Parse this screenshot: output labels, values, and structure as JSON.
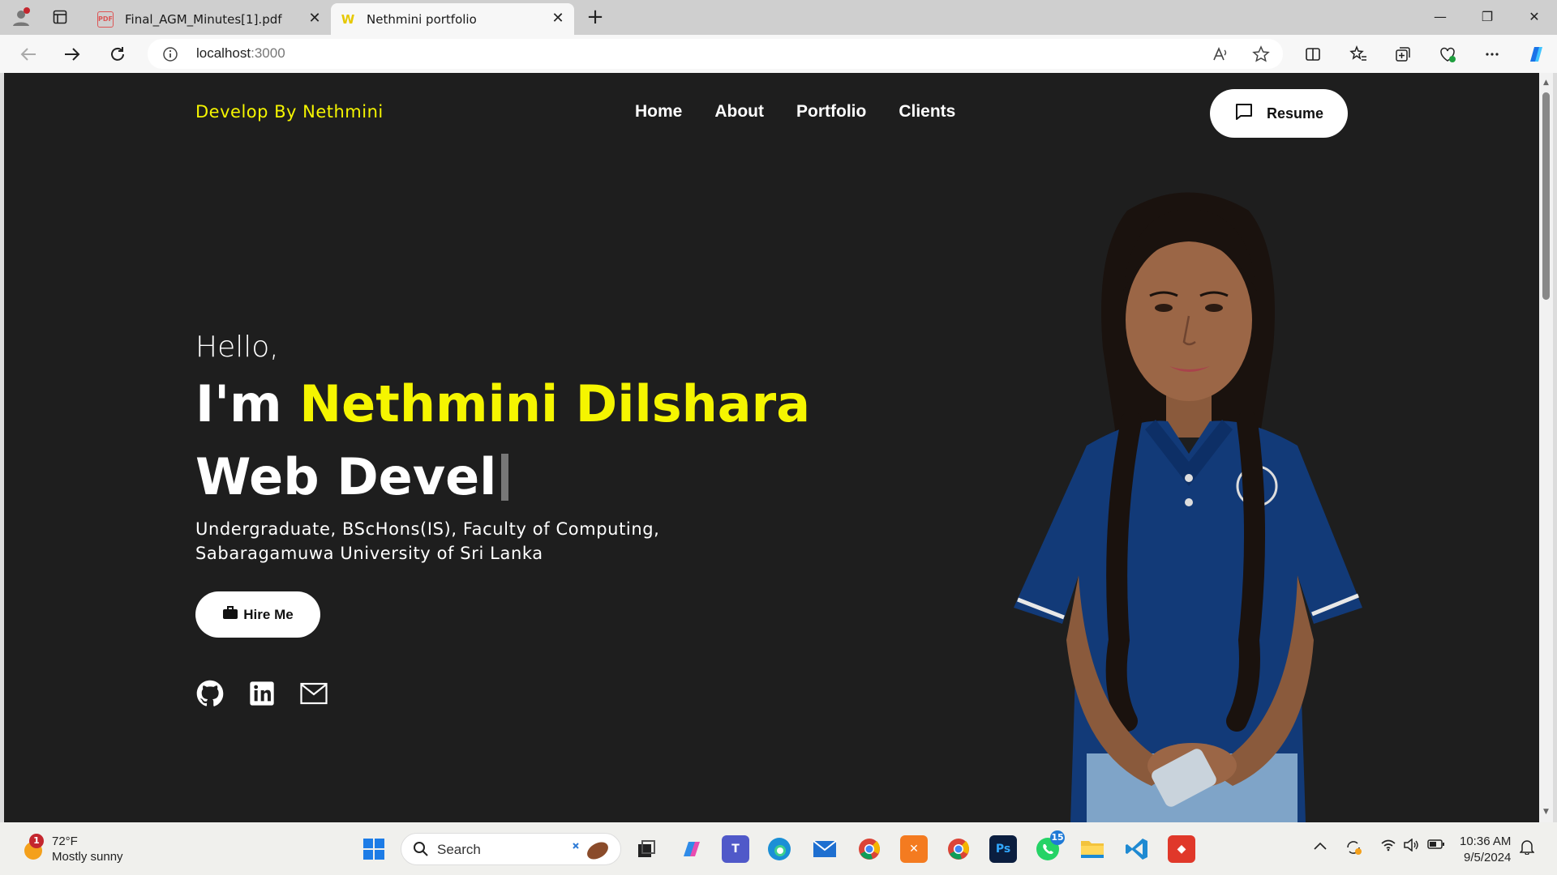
{
  "browser": {
    "tabs": [
      {
        "title": "Final_AGM_Minutes[1].pdf",
        "favicon": "pdf-icon",
        "active": false
      },
      {
        "title": "Nethmini portfolio",
        "favicon": "site-w-icon",
        "active": true
      }
    ],
    "url_host": "localhost",
    "url_port": ":3000"
  },
  "site": {
    "brand": "Develop By Nethmini",
    "nav": [
      "Home",
      "About",
      "Portfolio",
      "Clients"
    ],
    "resume_label": "Resume",
    "hello": "Hello,",
    "im": "I'm ",
    "name": "Nethmini Dilshara",
    "role_typed": "Web Devel",
    "desc_line1": "Undergraduate, BScHons(IS), Faculty of Computing,",
    "desc_line2": "Sabaragamuwa University of Sri Lanka",
    "hire_label": "Hire Me",
    "social": [
      "github-icon",
      "linkedin-icon",
      "mail-icon"
    ],
    "accent_color": "#f5f500",
    "bg_color": "#1e1e1e"
  },
  "taskbar": {
    "weather_temp": "72°F",
    "weather_desc": "Mostly sunny",
    "weather_badge": "1",
    "search_label": "Search",
    "whatsapp_badge": "15",
    "time": "10:36 AM",
    "date": "9/5/2024"
  }
}
